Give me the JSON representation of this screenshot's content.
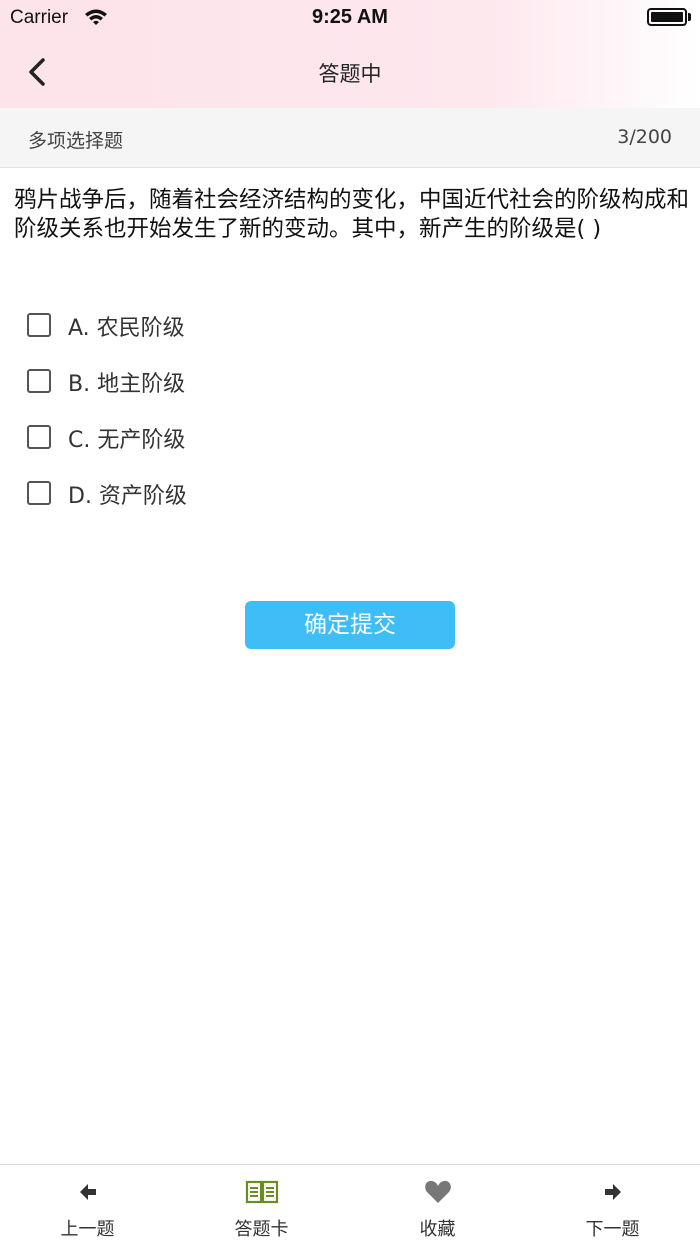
{
  "status_bar": {
    "carrier": "Carrier",
    "time": "9:25 AM"
  },
  "nav": {
    "title": "答题中",
    "back_icon": "chevron-left-icon"
  },
  "section": {
    "question_type": "多项选择题",
    "progress": "3/200"
  },
  "question": {
    "text": "鸦片战争后，随着社会经济结构的变化，中国近代社会的阶级构成和阶级关系也开始发生了新的变动。其中，新产生的阶级是(    )"
  },
  "options": [
    {
      "label": "A. 农民阶级",
      "checked": false
    },
    {
      "label": "B. 地主阶级",
      "checked": false
    },
    {
      "label": "C. 无产阶级",
      "checked": false
    },
    {
      "label": "D. 资产阶级",
      "checked": false
    }
  ],
  "submit": {
    "label": "确定提交",
    "color": "#3fbdf7"
  },
  "tabbar": {
    "items": [
      {
        "label": "上一题",
        "icon": "arrow-left-icon"
      },
      {
        "label": "答题卡",
        "icon": "open-book-icon",
        "color": "#6b8e23"
      },
      {
        "label": "收藏",
        "icon": "heart-icon",
        "color": "#777777"
      },
      {
        "label": "下一题",
        "icon": "arrow-right-icon"
      }
    ]
  }
}
